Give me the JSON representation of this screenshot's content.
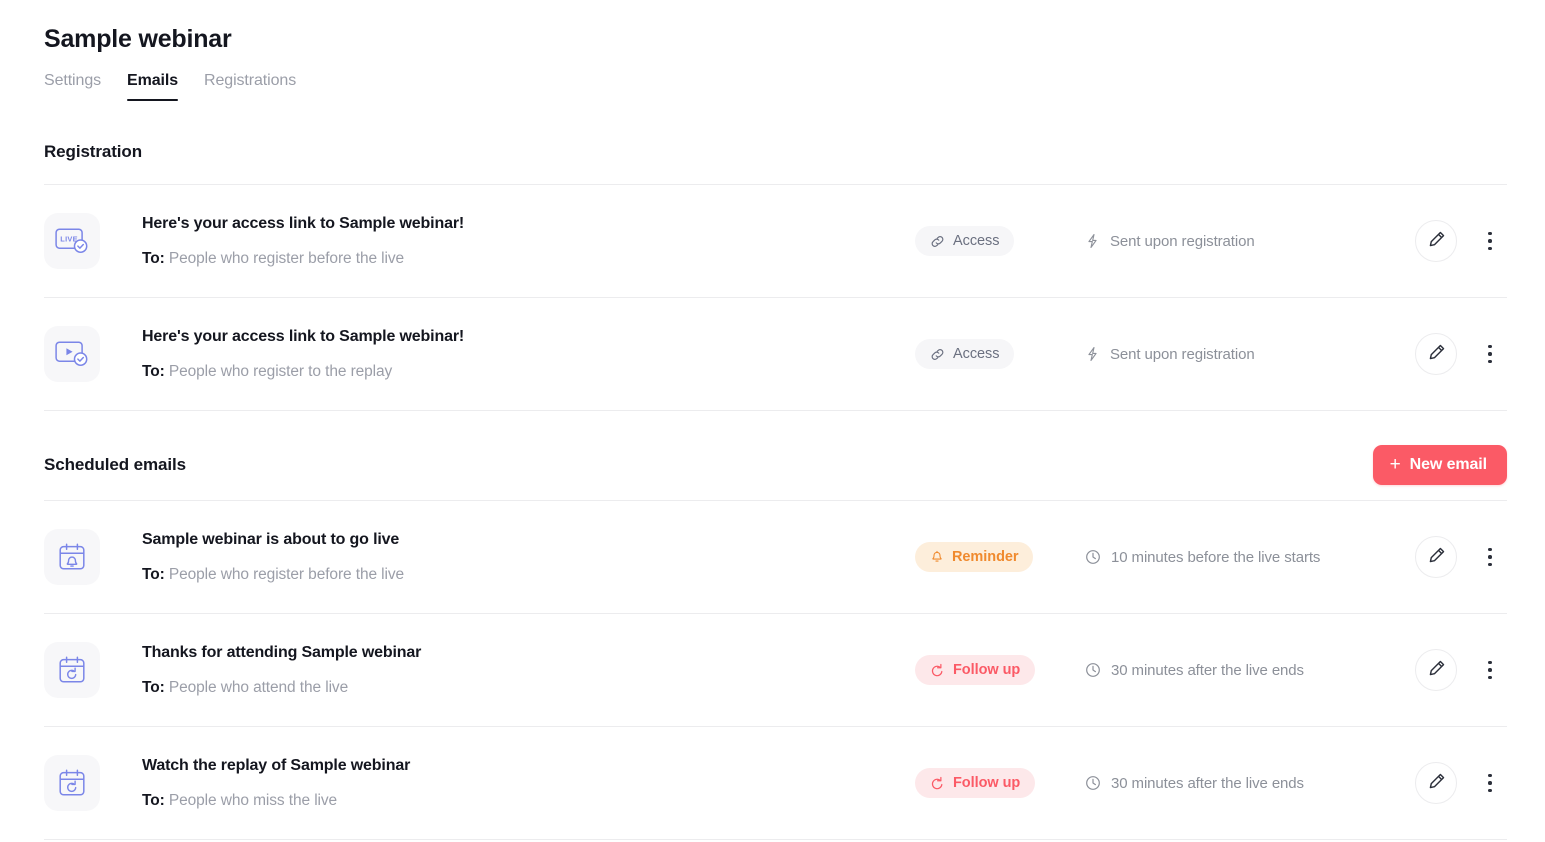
{
  "header": {
    "title": "Sample webinar",
    "tabs": [
      {
        "label": "Settings",
        "active": false
      },
      {
        "label": "Emails",
        "active": true
      },
      {
        "label": "Registrations",
        "active": false
      }
    ]
  },
  "sections": [
    {
      "id": "registration",
      "title": "Registration",
      "action": null,
      "rows": [
        {
          "icon": "live-video-check-icon",
          "subject": "Here's your access link to Sample webinar!",
          "to_label": "To:",
          "to_value": "People who register before the live",
          "badge": {
            "label": "Access",
            "type": "access",
            "icon": "link-icon"
          },
          "timing": {
            "text": "Sent upon registration",
            "icon": "bolt-icon"
          },
          "edit_label": "edit-icon",
          "more_label": "more-options-icon"
        },
        {
          "icon": "replay-video-check-icon",
          "subject": "Here's your access link to Sample webinar!",
          "to_label": "To:",
          "to_value": "People who register to the replay",
          "badge": {
            "label": "Access",
            "type": "access",
            "icon": "link-icon"
          },
          "timing": {
            "text": "Sent upon registration",
            "icon": "bolt-icon"
          },
          "edit_label": "edit-icon",
          "more_label": "more-options-icon"
        }
      ]
    },
    {
      "id": "scheduled-emails",
      "title": "Scheduled emails",
      "action": {
        "label": "New email",
        "icon": "plus-icon",
        "color": "#fb5a66"
      },
      "rows": [
        {
          "icon": "calendar-bell-icon",
          "subject": "Sample webinar is about to go live",
          "to_label": "To:",
          "to_value": "People who register before the live",
          "badge": {
            "label": "Reminder",
            "type": "reminder",
            "icon": "bell-icon"
          },
          "timing": {
            "text": "10 minutes before the live starts",
            "icon": "clock-icon"
          },
          "edit_label": "edit-icon",
          "more_label": "more-options-icon"
        },
        {
          "icon": "calendar-replay-icon",
          "subject": "Thanks for attending Sample webinar",
          "to_label": "To:",
          "to_value": "People who attend the live",
          "badge": {
            "label": "Follow up",
            "type": "followup",
            "icon": "rotate-left-icon"
          },
          "timing": {
            "text": "30 minutes after the live ends",
            "icon": "clock-icon"
          },
          "edit_label": "edit-icon",
          "more_label": "more-options-icon"
        },
        {
          "icon": "calendar-replay-icon",
          "subject": "Watch the replay of Sample webinar",
          "to_label": "To:",
          "to_value": "People who miss the live",
          "badge": {
            "label": "Follow up",
            "type": "followup",
            "icon": "rotate-left-icon"
          },
          "timing": {
            "text": "30 minutes after the live ends",
            "icon": "clock-icon"
          },
          "edit_label": "edit-icon",
          "more_label": "more-options-icon"
        }
      ]
    }
  ],
  "icon_text": {
    "live_badge": "LIVE"
  },
  "colors": {
    "accent": "#fb5a66",
    "reminder_text": "#f08a2e",
    "reminder_bg": "#fdeedb",
    "followup_bg": "#fde8ea",
    "icon_indigo": "#7b86e8",
    "tile_bg": "#f7f7f9",
    "divider": "#ececee",
    "muted_text": "#9b9ea8",
    "title_text": "#14161f"
  }
}
